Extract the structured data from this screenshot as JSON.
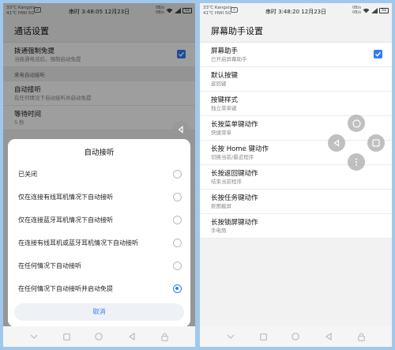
{
  "left_phone": {
    "status": {
      "carrier_line1": "33℃ Kangxin",
      "carrier_line2": "41℃ HWI 5G",
      "sim": "2",
      "time": "串时 3:48:05 12月23日",
      "speed_line1": "0B/s",
      "speed_line2": "0B/s",
      "battery": "51"
    },
    "title": "通话设置",
    "items": [
      {
        "title": "拨通强制免提",
        "subtitle": "当拨通电话后，强制启动免提",
        "checked": true
      }
    ],
    "section_header": "来电自动接听",
    "items2": [
      {
        "title": "自动接听",
        "subtitle": "在任何情况下自动接听并启动免提"
      },
      {
        "title": "等待时间",
        "subtitle": "5 秒"
      }
    ],
    "dialog": {
      "title": "自动接听",
      "options": [
        {
          "label": "已关闭",
          "selected": false
        },
        {
          "label": "仅在连接有线耳机情况下自动接听",
          "selected": false
        },
        {
          "label": "仅在连接蓝牙耳机情况下自动接听",
          "selected": false
        },
        {
          "label": "在连接有线耳机或蓝牙耳机情况下自动接听",
          "selected": false
        },
        {
          "label": "在任何情况下自动接听",
          "selected": false
        },
        {
          "label": "在任何情况下自动接听并启动免提",
          "selected": true
        }
      ],
      "cancel_label": "取消"
    }
  },
  "right_phone": {
    "status": {
      "carrier_line1": "33℃ Kangxin",
      "carrier_line2": "41℃ HWI 5G",
      "sim": "2",
      "time": "串时 3:48:20 12月23日",
      "speed_line1": "0B/s",
      "speed_line2": "0B/s",
      "battery": "51"
    },
    "title": "屏幕助手设置",
    "items": [
      {
        "title": "屏幕助手",
        "subtitle": "已开启屏幕助手",
        "checked": true
      },
      {
        "title": "默认按键",
        "subtitle": "返回键"
      },
      {
        "title": "按键样式",
        "subtitle": "独立菜单键"
      },
      {
        "title": "长按菜单键动作",
        "subtitle": "快捷菜单"
      },
      {
        "title": "长按 Home 键动作",
        "subtitle": "切换当前/最近程序"
      },
      {
        "title": "长按返回键动作",
        "subtitle": "结束当前程序"
      },
      {
        "title": "长按任务键动作",
        "subtitle": "抠图截屏"
      },
      {
        "title": "长按锁屏键动作",
        "subtitle": "手电筒"
      }
    ]
  },
  "colors": {
    "accent": "#2f7df6",
    "background": "#9fc9ec"
  }
}
